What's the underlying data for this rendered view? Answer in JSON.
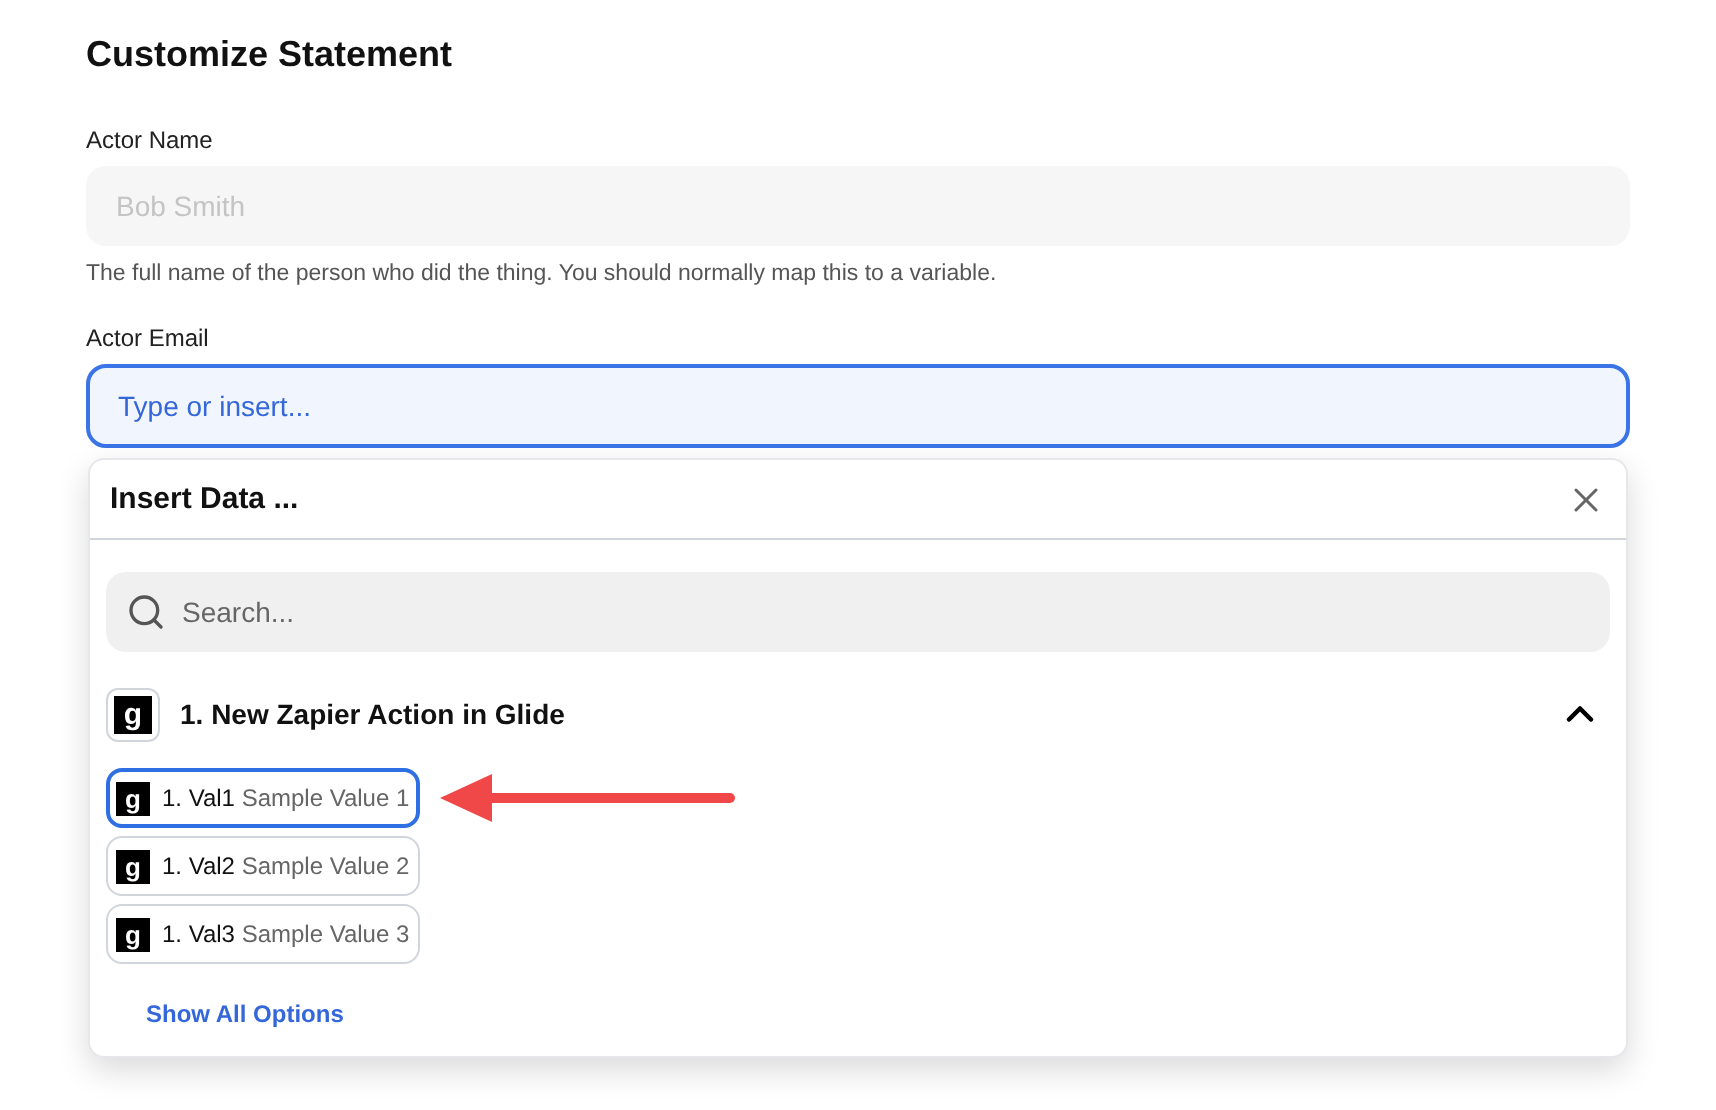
{
  "heading": "Customize Statement",
  "fields": [
    {
      "label": "Actor Name",
      "placeholder": "Bob Smith",
      "focused": false,
      "hint": "The full name of the person who did the thing. You should normally map this to a variable."
    },
    {
      "label": "Actor Email",
      "placeholder": "Type or insert...",
      "focused": true
    }
  ],
  "popup": {
    "title": "Insert Data ...",
    "search": {
      "placeholder": "Search..."
    },
    "group": {
      "title": "1. New Zapier Action in Glide",
      "logo": "g",
      "expanded": true
    },
    "items": [
      {
        "logo": "g",
        "name": "1. Val1",
        "value": "Sample Value 1",
        "selected": true
      },
      {
        "logo": "g",
        "name": "1. Val2",
        "value": "Sample Value 2",
        "selected": false
      },
      {
        "logo": "g",
        "name": "1. Val3",
        "value": "Sample Value 3",
        "selected": false
      }
    ],
    "show_all": "Show All Options"
  }
}
